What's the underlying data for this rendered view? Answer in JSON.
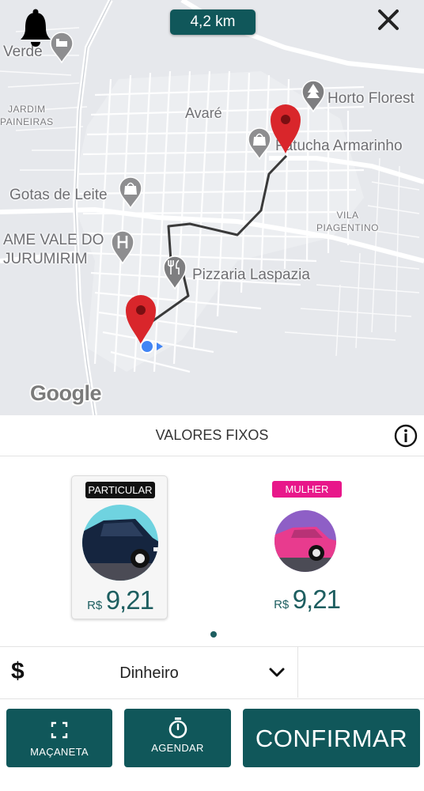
{
  "map": {
    "distance": "4,2 km",
    "labels": {
      "verde": "Verde",
      "jardim_paineiras": "JARDIM\nPAINEIRAS",
      "avare": "Avaré",
      "horto": "Horto Florest",
      "armarinho": "Fatucha Armarinho",
      "gotas": "Gotas de Leite",
      "ame_vale": "AME VALE DO\nJURUMIRIM",
      "vila_piagentino": "VILA\nPIAGENTINO",
      "pizzaria": "Pizzaria Laspazia"
    },
    "attribution": "Google",
    "route_color": "#3a3a3a",
    "pin_color": "#d9262b",
    "location_color": "#4285f4"
  },
  "header": {
    "bell_icon": "bell-icon",
    "close_icon": "close-icon"
  },
  "fare": {
    "title": "VALORES FIXOS",
    "info_icon": "info-icon"
  },
  "vehicles": [
    {
      "category": "PARTICULAR",
      "currency": "R$",
      "price": "9,21",
      "badge_color": "#111111",
      "selected": true
    },
    {
      "category": "MULHER",
      "currency": "R$",
      "price": "9,21",
      "badge_color": "#e8178a",
      "selected": false
    }
  ],
  "pager": {
    "pages": 1,
    "current": 1
  },
  "payment": {
    "icon": "dollar-icon",
    "icon_text": "$",
    "method": "Dinheiro",
    "chevron": "chevron-down-icon"
  },
  "actions": {
    "macaneta": "MAÇANETA",
    "agendar": "AGENDAR",
    "confirmar": "CONFIRMAR"
  },
  "colors": {
    "primary": "#10575a",
    "price_text": "#1d5e60",
    "pink": "#e8178a"
  }
}
